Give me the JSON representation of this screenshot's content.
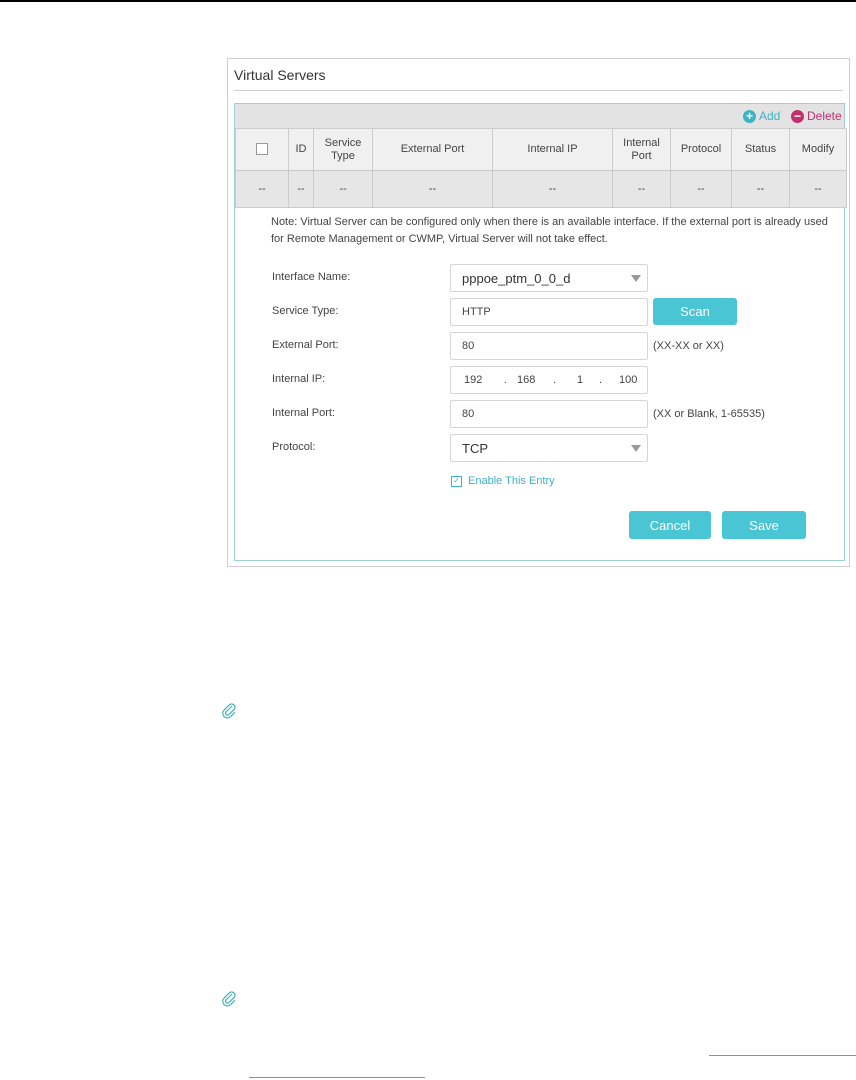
{
  "panel": {
    "title": "Virtual Servers"
  },
  "toolbar": {
    "add_label": "Add",
    "delete_label": "Delete"
  },
  "table": {
    "headers": [
      "",
      "ID",
      "Service Type",
      "External Port",
      "Internal IP",
      "Internal Port",
      "Protocol",
      "Status",
      "Modify"
    ],
    "empty_row": [
      "--",
      "--",
      "--",
      "--",
      "--",
      "--",
      "--",
      "--",
      "--"
    ]
  },
  "form": {
    "note": "Note: Virtual Server can be configured only when there is an available interface. If the external port is already used for Remote Management or CWMP, Virtual Server will not take effect.",
    "interface_name": {
      "label": "Interface Name:",
      "value": "pppoe_ptm_0_0_d"
    },
    "service_type": {
      "label": "Service Type:",
      "value": "HTTP",
      "scan_label": "Scan"
    },
    "external_port": {
      "label": "External Port:",
      "value": "80",
      "hint": "(XX-XX or XX)"
    },
    "internal_ip": {
      "label": "Internal IP:",
      "octets": [
        "192",
        "168",
        "1",
        "100"
      ]
    },
    "internal_port": {
      "label": "Internal Port:",
      "value": "80",
      "hint": "(XX or Blank, 1-65535)"
    },
    "protocol": {
      "label": "Protocol:",
      "value": "TCP"
    },
    "enable_entry": {
      "label": "Enable This Entry",
      "checked": true
    },
    "cancel_label": "Cancel",
    "save_label": "Save"
  },
  "colors": {
    "accent": "#4ac5d3",
    "delete": "#c0306e",
    "add": "#3db3c2"
  },
  "icons": [
    "add-icon",
    "delete-icon",
    "chevron-down-icon",
    "checkbox-icon",
    "paperclip-icon"
  ]
}
